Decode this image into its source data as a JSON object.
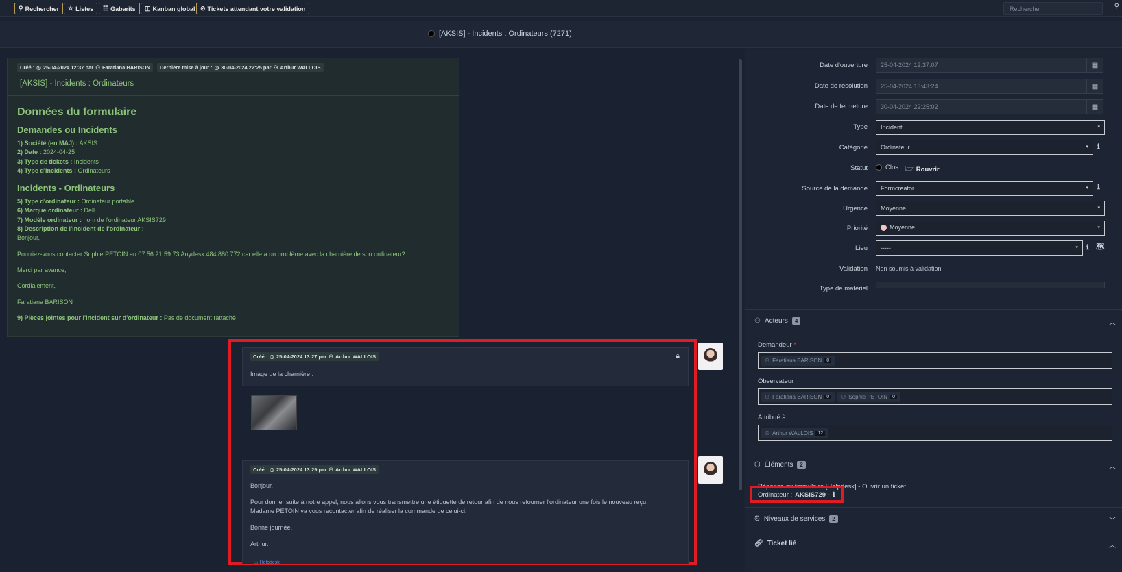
{
  "toolbar": {
    "buttons": [
      "Rechercher",
      "Listes",
      "Gabarits",
      "Kanban global",
      "Tickets attendant votre validation"
    ],
    "search_placeholder": "Rechercher"
  },
  "page": {
    "title": "[AKSIS] - Incidents : Ordinateurs (7271)"
  },
  "main_item": {
    "created_label": "Créé :",
    "created_date": "25-04-2024 12:37 par",
    "created_by": "Faratiana BARISON",
    "updated_label": "Dernière mise à jour :",
    "updated_date": "30-04-2024 22:25 par",
    "updated_by": "Arthur WALLOIS",
    "subtitle": "[AKSIS] - Incidents : Ordinateurs",
    "h1": "Données du formulaire",
    "section1_title": "Demandes ou Incidents",
    "section1_fields": [
      {
        "label": "1) Société (en MAJ) :",
        "value": "AKSIS"
      },
      {
        "label": "2) Date :",
        "value": "2024-04-25"
      },
      {
        "label": "3) Type de tickets :",
        "value": "Incidents"
      },
      {
        "label": "4) Type d'incidents :",
        "value": "Ordinateurs"
      }
    ],
    "section2_title": "Incidents - Ordinateurs",
    "section2_fields": [
      {
        "label": "5) Type d'ordinateur :",
        "value": "Ordinateur portable"
      },
      {
        "label": "6) Marque ordinateur :",
        "value": "Dell"
      },
      {
        "label": "7) Modèle ordinateur :",
        "value": "nom de l'ordinateur AKSIS729"
      },
      {
        "label": "8) Description de l'incident de l'ordinateur :",
        "value": ""
      }
    ],
    "body_lines": [
      "Bonjour,",
      "Pourriez-vous contacter Sophie PETOIN au 07 56 21 59 73 Anydesk 484 880 772 car elle a un problème avec la charnière de son ordinateur?",
      "Merci par avance,",
      "Cordialement,",
      "Faratiana BARISON"
    ],
    "attachments_label": "9) Pièces jointes pour l'incident sur d'ordinateur :",
    "attachments_value": "Pas de document rattaché"
  },
  "followups": [
    {
      "created_label": "Créé :",
      "date": "25-04-2024 13:27 par",
      "author": "Arthur WALLOIS",
      "lines": [
        "Image de la charnière :"
      ]
    },
    {
      "created_label": "Créé :",
      "date": "25-04-2024 13:29 par",
      "author": "Arthur WALLOIS",
      "lines": [
        "Bonjour,",
        "Pour donner suite à notre appel, nous allons vous transmettre une étiquette de retour afin de nous retourner l'ordinateur une fois le nouveau reçu. Madame PETOIN va vous recontacter afin de réaliser la commande de celui-ci.",
        "Bonne journée,",
        "Arthur."
      ],
      "source": "Helpdesk"
    }
  ],
  "right_panel": {
    "fields": [
      {
        "label": "Date d'ouverture",
        "value": "25-04-2024 12:37:07"
      },
      {
        "label": "Date de résolution",
        "value": "25-04-2024 13:43:24"
      },
      {
        "label": "Date de fermeture",
        "value": "30-04-2024 22:25:02"
      },
      {
        "label": "Type",
        "value": "Incident"
      },
      {
        "label": "Catégorie",
        "value": "Ordinateur"
      },
      {
        "label": "Statut",
        "value": "Clos"
      },
      {
        "label": "Source de la demande",
        "value": "Formcreator"
      },
      {
        "label": "Urgence",
        "value": "Moyenne"
      },
      {
        "label": "Priorité",
        "value": "Moyenne"
      },
      {
        "label": "Lieu",
        "value": "-----"
      },
      {
        "label": "Validation",
        "value": "Non soumis à validation"
      },
      {
        "label": "Type de matériel",
        "value": ""
      }
    ],
    "reopen_label": "Rouvrir",
    "actors": {
      "title": "Acteurs",
      "count": "4",
      "requester_label": "Demandeur",
      "required_mark": "*",
      "requester": [
        {
          "name": "Faratiana BARISON",
          "count": "0"
        }
      ],
      "observer_label": "Observateur",
      "observers": [
        {
          "name": "Faratiana BARISON",
          "count": "0"
        },
        {
          "name": "Sophie PETOIN",
          "count": "0"
        }
      ],
      "assigned_label": "Attribué à",
      "assigned": [
        {
          "name": "Arthur WALLOIS",
          "count": "12"
        }
      ]
    },
    "elements": {
      "title": "Éléments",
      "count": "2",
      "line1": "Réponse au formulaire [Helpdesk] - Ouvrir un ticket",
      "line2_label": "Ordinateur :",
      "line2_value": "AKSIS729 -"
    },
    "sla": {
      "title": "Niveaux de services",
      "count": "2"
    },
    "linked": {
      "title": "Ticket lié"
    }
  },
  "colors": {
    "highlight": "#e01b24",
    "form_text": "#8cc47a",
    "link": "#5a8fe6"
  }
}
